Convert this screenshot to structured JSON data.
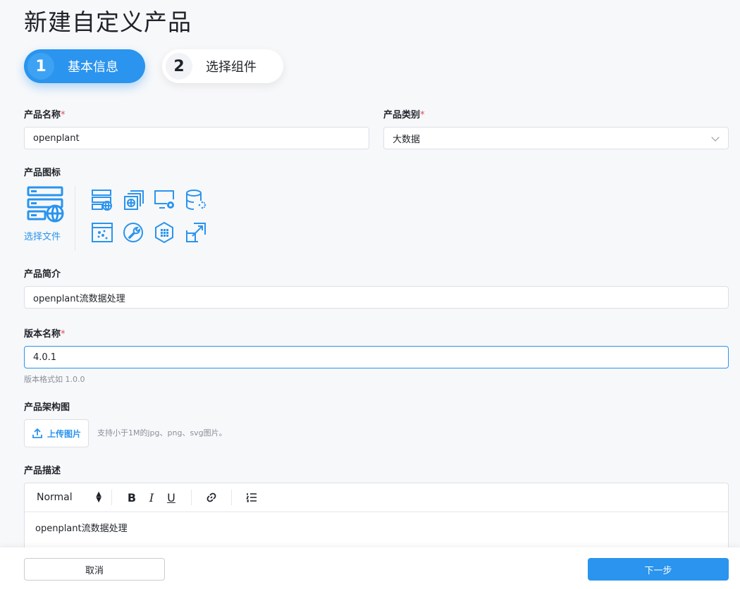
{
  "page": {
    "title": "新建自定义产品"
  },
  "steps": [
    {
      "number": "1",
      "label": "基本信息",
      "active": true
    },
    {
      "number": "2",
      "label": "选择组件",
      "active": false
    }
  ],
  "form": {
    "product_name": {
      "label": "产品名称",
      "required": "*",
      "value": "openplant"
    },
    "product_category": {
      "label": "产品类别",
      "required": "*",
      "value": "大数据"
    },
    "product_icon": {
      "label": "产品图标",
      "choose_file": "选择文件",
      "icons": [
        "server-network-icon",
        "cube-stack-icon",
        "monitor-gear-icon",
        "database-loading-icon",
        "browser-dots-icon",
        "wrench-icon",
        "hexagon-grid-icon",
        "expand-arrows-icon"
      ]
    },
    "product_intro": {
      "label": "产品简介",
      "value": "openplant流数据处理"
    },
    "version_name": {
      "label": "版本名称",
      "required": "*",
      "value": "4.0.1",
      "hint": "版本格式如 1.0.0"
    },
    "architecture": {
      "label": "产品架构图",
      "upload_label": "上传图片",
      "hint": "支持小于1M的jpg、png、svg图片。"
    },
    "description": {
      "label": "产品描述",
      "toolbar": {
        "format_select": "Normal",
        "bold": "B",
        "italic": "I",
        "underline": "U"
      },
      "content": "openplant流数据处理"
    }
  },
  "footer": {
    "cancel_label": "取消",
    "next_label": "下一步"
  },
  "colors": {
    "primary": "#2a94ee",
    "required": "#e34d59",
    "background": "#f7f8fa"
  }
}
